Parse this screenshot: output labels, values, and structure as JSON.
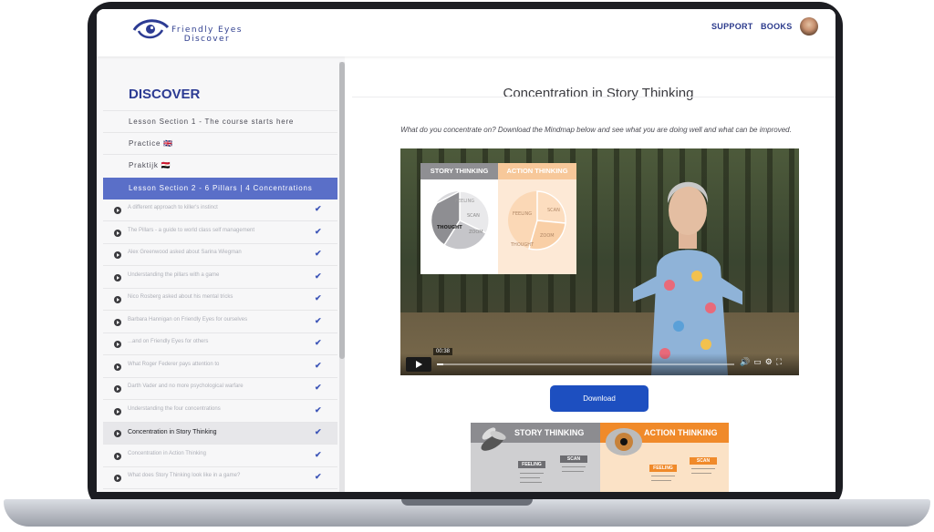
{
  "header": {
    "logo_line1": "Friendly Eyes",
    "logo_line2": "Discover",
    "nav": [
      "SUPPORT",
      "BOOKS"
    ]
  },
  "sidebar": {
    "title": "DISCOVER",
    "sections": [
      "Lesson Section 1 - The course starts here",
      "Practice 🇬🇧",
      "Praktijk 🇪🇬",
      "Lesson Section 2 - 6 Pillars | 4 Concentrations"
    ],
    "lessons": [
      {
        "label": "A different approach to killer's instinct",
        "done": "✔"
      },
      {
        "label": "The Pillars - a guide to world class self management",
        "done": "✔"
      },
      {
        "label": "Alex Greenwood asked about Sarina Wiegman",
        "done": "✔"
      },
      {
        "label": "Understanding the pillars with a game",
        "done": "✔"
      },
      {
        "label": "Nico Rosberg asked about his mental tricks",
        "done": "✔"
      },
      {
        "label": "Barbara Hannigan on Friendly Eyes for ourselves",
        "done": "✔"
      },
      {
        "label": "...and on Friendly Eyes for others",
        "done": "✔"
      },
      {
        "label": "What Roger Federer pays attention to",
        "done": "✔"
      },
      {
        "label": "Darth Vader and no more psychological warfare",
        "done": "✔"
      },
      {
        "label": "Understanding the four concentrations",
        "done": "✔"
      },
      {
        "label": "Concentration in Story Thinking",
        "done": "✔"
      },
      {
        "label": "Concentration in Action Thinking",
        "done": "✔"
      },
      {
        "label": "What does Story Thinking look like in a game?",
        "done": "✔"
      }
    ],
    "current_index": 10
  },
  "main": {
    "title": "Concentration in Story Thinking",
    "intro": "What do you concentrate on? Download the Mindmap below and see what you are doing well and what can be improved.",
    "video": {
      "time": "00:38",
      "progress": 0.02,
      "slide_left_heading": "STORY THINKING",
      "slide_right_heading": "ACTION THINKING",
      "left_pie": [
        "FEELING",
        "SCAN",
        "ZOOM",
        "THOUGHT"
      ],
      "right_pie": [
        "FEELING",
        "SCAN",
        "ZOOM",
        "THOUGHT"
      ]
    },
    "download_label": "Download",
    "preview": {
      "left_heading": "STORY THINKING",
      "right_heading": "ACTION THINKING",
      "left_tags": [
        "FEELING",
        "SCAN"
      ],
      "right_tags": [
        "FEELING",
        "SCAN"
      ]
    }
  },
  "colors": {
    "brand": "#2c3b93",
    "active_section": "#5a6fc8",
    "button": "#1d4fc0",
    "action_orange": "#f08a2a"
  }
}
